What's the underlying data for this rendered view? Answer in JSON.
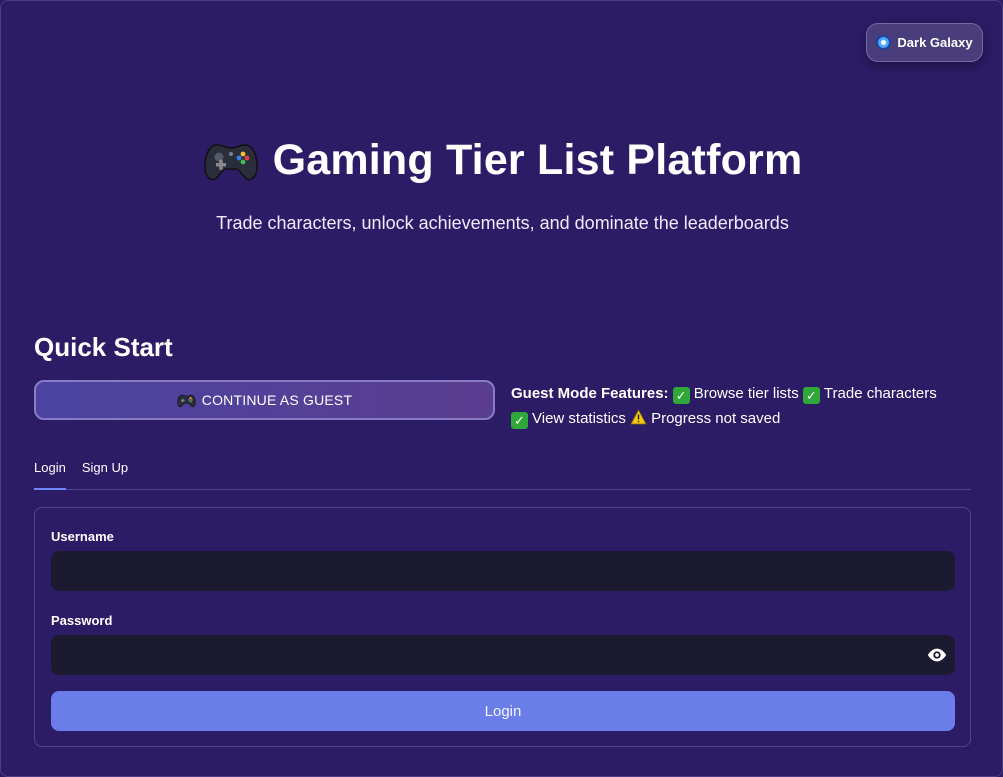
{
  "theme": {
    "label": "Dark Galaxy",
    "icon": "galaxy-icon"
  },
  "hero": {
    "title": "Gaming Tier List Platform",
    "title_icon": "gamepad-icon",
    "subtitle": "Trade characters, unlock achievements, and dominate the leaderboards"
  },
  "quick_start": {
    "heading": "Quick Start",
    "guest_button_label": "CONTINUE AS GUEST",
    "guest_button_icon": "gamepad-icon"
  },
  "guest_features": {
    "heading": "Guest Mode Features:",
    "items": [
      {
        "icon": "check-icon",
        "text": "Browse tier lists"
      },
      {
        "icon": "check-icon",
        "text": "Trade characters"
      },
      {
        "icon": "check-icon",
        "text": "View statistics"
      },
      {
        "icon": "warning-icon",
        "text": "Progress not saved"
      }
    ]
  },
  "tabs": [
    {
      "label": "Login",
      "active": true
    },
    {
      "label": "Sign Up",
      "active": false
    }
  ],
  "login_form": {
    "username_label": "Username",
    "username_value": "",
    "password_label": "Password",
    "password_value": "",
    "submit_label": "Login"
  },
  "colors": {
    "background": "#2c1c66",
    "accent": "#6a7de8",
    "input_bg": "#1c1a30",
    "check": "#2fa839"
  }
}
